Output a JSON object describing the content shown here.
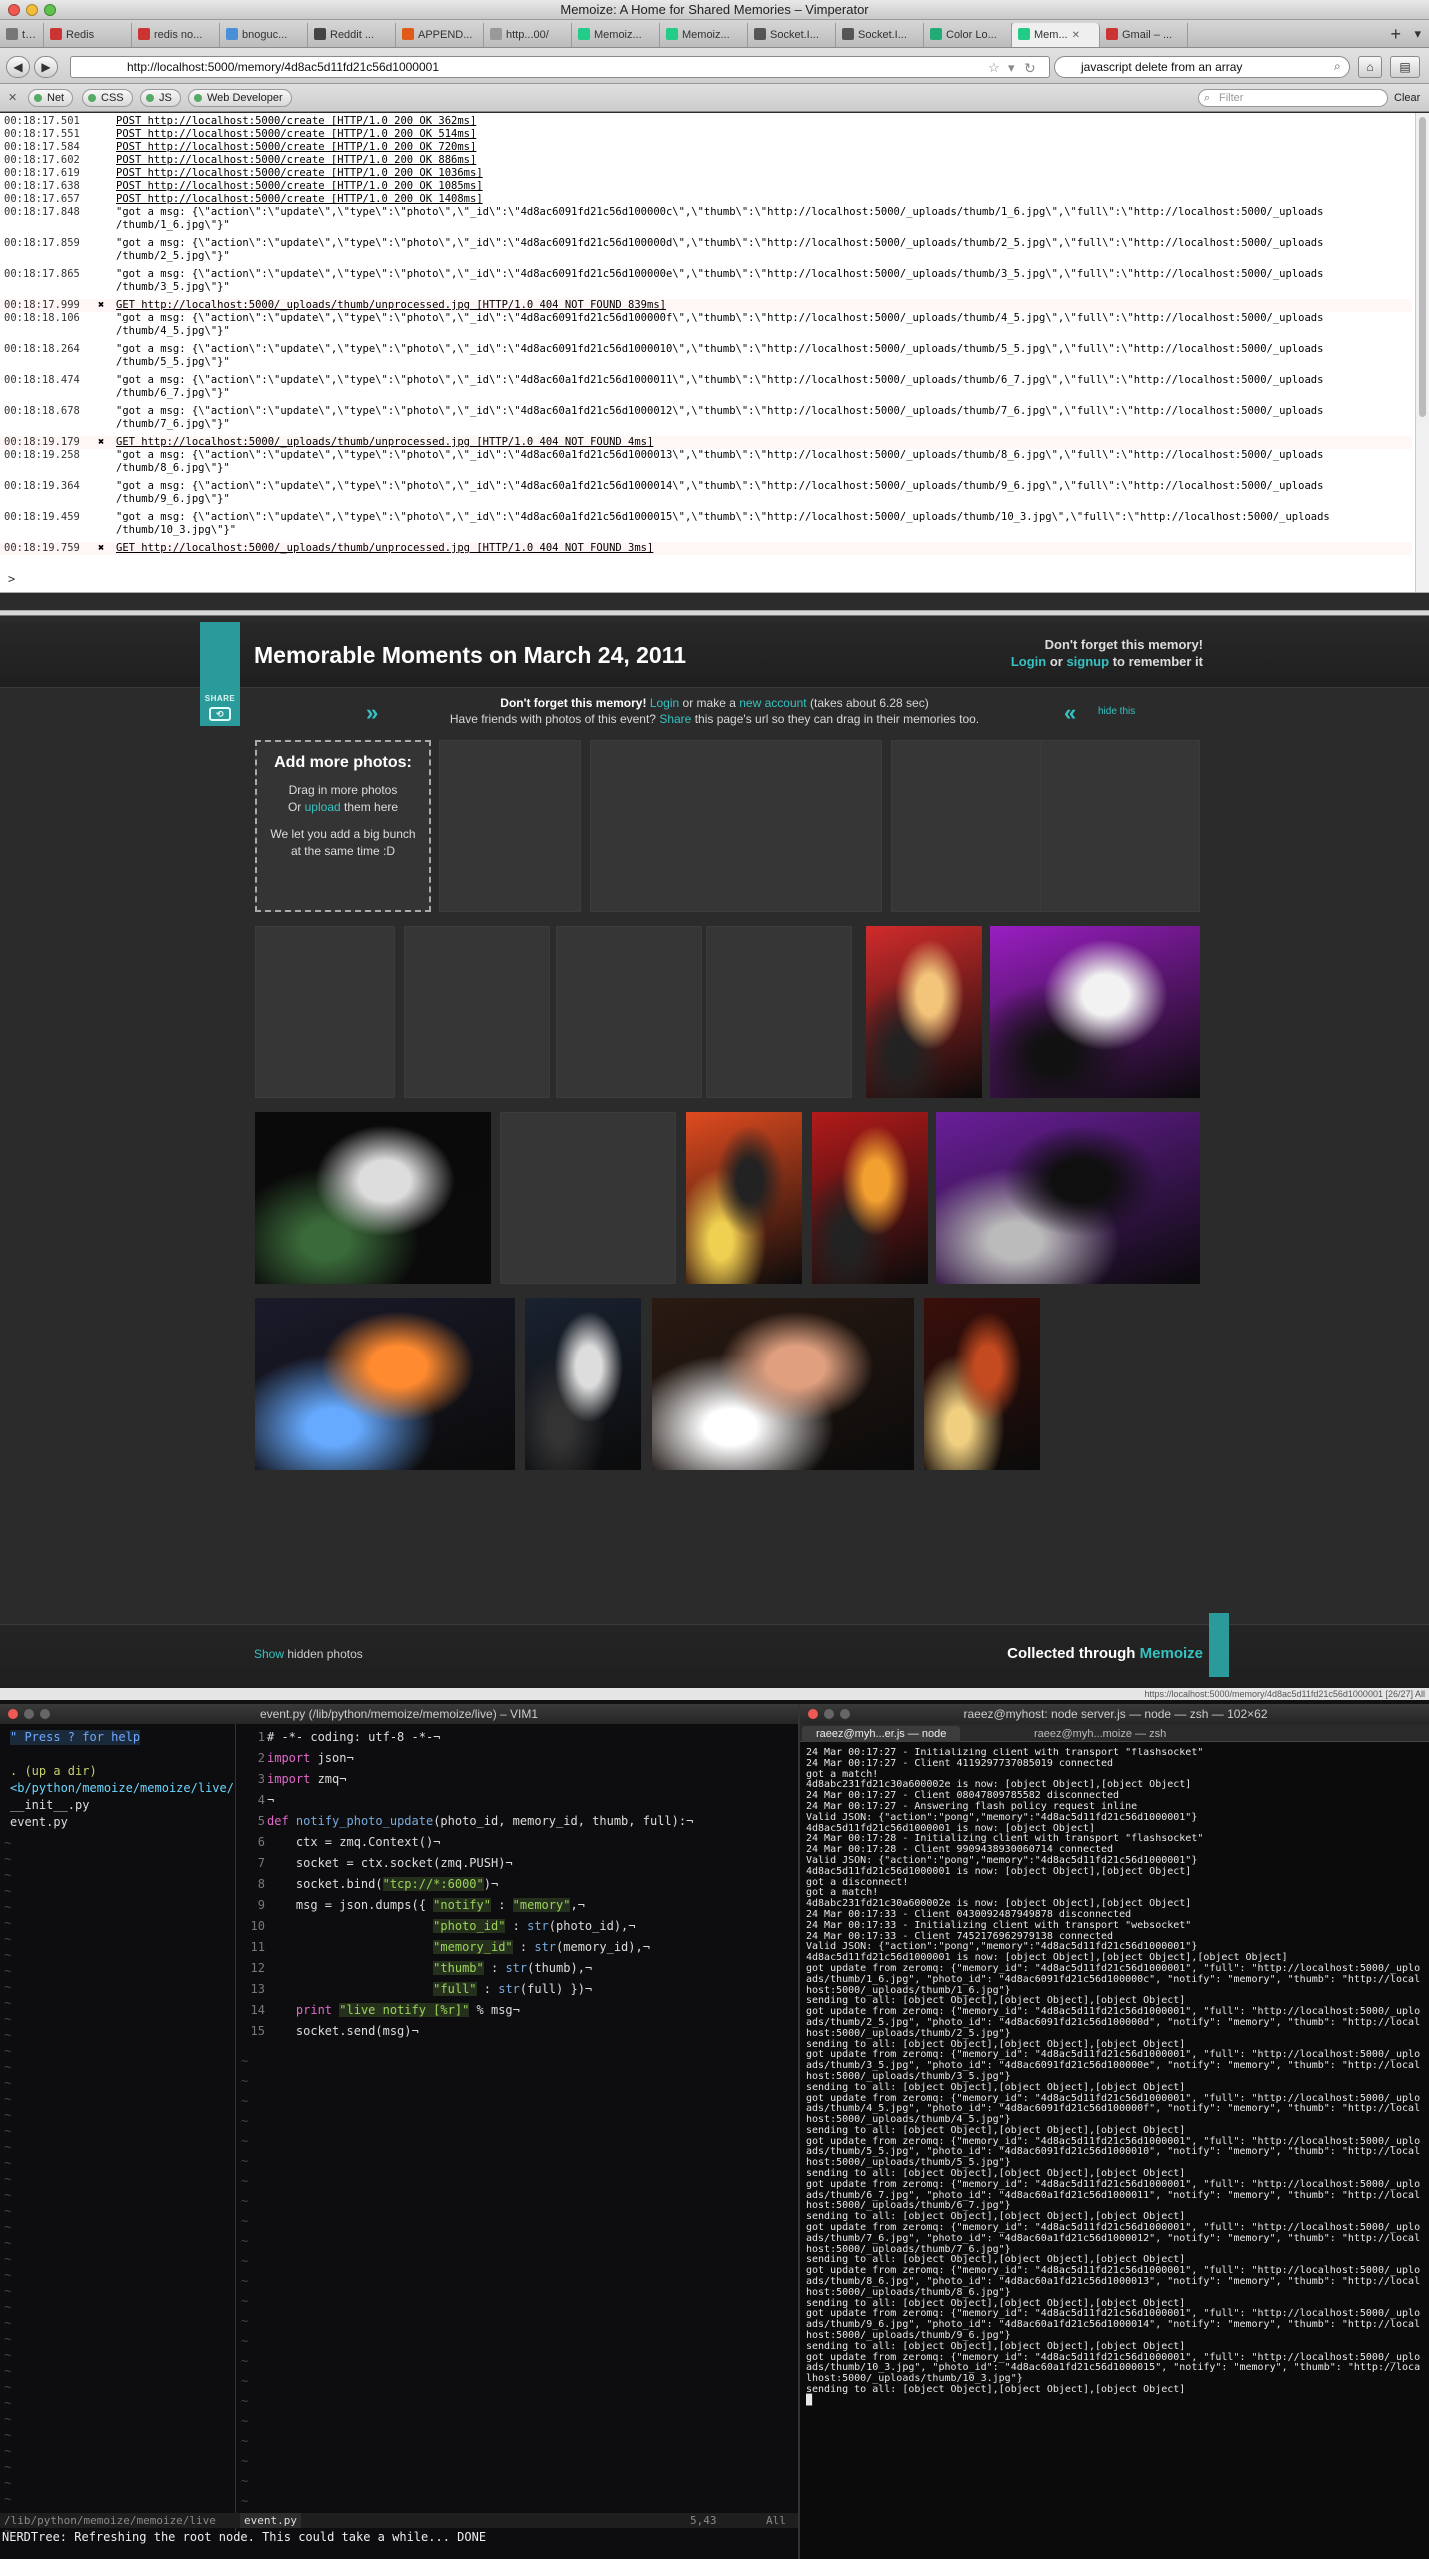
{
  "window": {
    "title": "Memoize: A Home for Shared Memories – Vimperator"
  },
  "tabs": [
    {
      "label": "tu..."
    },
    {
      "label": "Redis"
    },
    {
      "label": "redis no..."
    },
    {
      "label": "bnoguc..."
    },
    {
      "label": "Reddit ..."
    },
    {
      "label": "APPEND..."
    },
    {
      "label": "http...00/"
    },
    {
      "label": "Memoiz..."
    },
    {
      "label": "Memoiz..."
    },
    {
      "label": "Socket.I..."
    },
    {
      "label": "Socket.I..."
    },
    {
      "label": "Color Lo..."
    },
    {
      "label": "Mem..."
    },
    {
      "label": "Gmail – ..."
    }
  ],
  "nav": {
    "back": "◀",
    "forward": "▶",
    "url": "http://localhost:5000/memory/4d8ac5d11fd21c56d1000001",
    "site_badge": "S",
    "search_value": "javascript delete from an array",
    "new_tab": "+"
  },
  "addons": {
    "net": "Net",
    "css": "CSS",
    "js": "JS",
    "webdev": "Web Developer",
    "filter_placeholder": "Filter",
    "clear": "Clear"
  },
  "console": {
    "lines": [
      {
        "ts": "00:18:17.501",
        "mk": "",
        "msg": "POST http://localhost:5000/create [HTTP/1.0 200 OK 362ms]"
      },
      {
        "ts": "00:18:17.551",
        "mk": "",
        "msg": "POST http://localhost:5000/create [HTTP/1.0 200 OK 514ms]"
      },
      {
        "ts": "00:18:17.584",
        "mk": "",
        "msg": "POST http://localhost:5000/create [HTTP/1.0 200 OK 720ms]"
      },
      {
        "ts": "00:18:17.602",
        "mk": "",
        "msg": "POST http://localhost:5000/create [HTTP/1.0 200 OK 886ms]"
      },
      {
        "ts": "00:18:17.619",
        "mk": "",
        "msg": "POST http://localhost:5000/create [HTTP/1.0 200 OK 1036ms]"
      },
      {
        "ts": "00:18:17.638",
        "mk": "",
        "msg": "POST http://localhost:5000/create [HTTP/1.0 200 OK 1085ms]"
      },
      {
        "ts": "00:18:17.657",
        "mk": "",
        "msg": "POST http://localhost:5000/create [HTTP/1.0 200 OK 1408ms]"
      },
      {
        "ts": "00:18:17.848",
        "mk": "",
        "msg": "\"got a msg: {\\\"action\\\":\\\"update\\\",\\\"type\\\":\\\"photo\\\",\\\"_id\\\":\\\"4d8ac6091fd21c56d100000c\\\",\\\"thumb\\\":\\\"http://localhost:5000/_uploads/thumb/1_6.jpg\\\",\\\"full\\\":\\\"http://localhost:5000/_uploads\n/thumb/1_6.jpg\\\"}\""
      },
      {
        "ts": "00:18:17.859",
        "mk": "",
        "msg": "\"got a msg: {\\\"action\\\":\\\"update\\\",\\\"type\\\":\\\"photo\\\",\\\"_id\\\":\\\"4d8ac6091fd21c56d100000d\\\",\\\"thumb\\\":\\\"http://localhost:5000/_uploads/thumb/2_5.jpg\\\",\\\"full\\\":\\\"http://localhost:5000/_uploads\n/thumb/2_5.jpg\\\"}\""
      },
      {
        "ts": "00:18:17.865",
        "mk": "",
        "msg": "\"got a msg: {\\\"action\\\":\\\"update\\\",\\\"type\\\":\\\"photo\\\",\\\"_id\\\":\\\"4d8ac6091fd21c56d100000e\\\",\\\"thumb\\\":\\\"http://localhost:5000/_uploads/thumb/3_5.jpg\\\",\\\"full\\\":\\\"http://localhost:5000/_uploads\n/thumb/3_5.jpg\\\"}\""
      },
      {
        "ts": "00:18:17.999",
        "mk": "✖",
        "msg": "GET http://localhost:5000/_uploads/thumb/unprocessed.jpg [HTTP/1.0 404 NOT FOUND 839ms]"
      },
      {
        "ts": "00:18:18.106",
        "mk": "",
        "msg": "\"got a msg: {\\\"action\\\":\\\"update\\\",\\\"type\\\":\\\"photo\\\",\\\"_id\\\":\\\"4d8ac6091fd21c56d100000f\\\",\\\"thumb\\\":\\\"http://localhost:5000/_uploads/thumb/4_5.jpg\\\",\\\"full\\\":\\\"http://localhost:5000/_uploads\n/thumb/4_5.jpg\\\"}\""
      },
      {
        "ts": "00:18:18.264",
        "mk": "",
        "msg": "\"got a msg: {\\\"action\\\":\\\"update\\\",\\\"type\\\":\\\"photo\\\",\\\"_id\\\":\\\"4d8ac6091fd21c56d1000010\\\",\\\"thumb\\\":\\\"http://localhost:5000/_uploads/thumb/5_5.jpg\\\",\\\"full\\\":\\\"http://localhost:5000/_uploads\n/thumb/5_5.jpg\\\"}\""
      },
      {
        "ts": "00:18:18.474",
        "mk": "",
        "msg": "\"got a msg: {\\\"action\\\":\\\"update\\\",\\\"type\\\":\\\"photo\\\",\\\"_id\\\":\\\"4d8ac60a1fd21c56d1000011\\\",\\\"thumb\\\":\\\"http://localhost:5000/_uploads/thumb/6_7.jpg\\\",\\\"full\\\":\\\"http://localhost:5000/_uploads\n/thumb/6_7.jpg\\\"}\""
      },
      {
        "ts": "00:18:18.678",
        "mk": "",
        "msg": "\"got a msg: {\\\"action\\\":\\\"update\\\",\\\"type\\\":\\\"photo\\\",\\\"_id\\\":\\\"4d8ac60a1fd21c56d1000012\\\",\\\"thumb\\\":\\\"http://localhost:5000/_uploads/thumb/7_6.jpg\\\",\\\"full\\\":\\\"http://localhost:5000/_uploads\n/thumb/7_6.jpg\\\"}\""
      },
      {
        "ts": "00:18:19.179",
        "mk": "✖",
        "msg": "GET http://localhost:5000/_uploads/thumb/unprocessed.jpg [HTTP/1.0 404 NOT FOUND 4ms]"
      },
      {
        "ts": "00:18:19.258",
        "mk": "",
        "msg": "\"got a msg: {\\\"action\\\":\\\"update\\\",\\\"type\\\":\\\"photo\\\",\\\"_id\\\":\\\"4d8ac60a1fd21c56d1000013\\\",\\\"thumb\\\":\\\"http://localhost:5000/_uploads/thumb/8_6.jpg\\\",\\\"full\\\":\\\"http://localhost:5000/_uploads\n/thumb/8_6.jpg\\\"}\""
      },
      {
        "ts": "00:18:19.364",
        "mk": "",
        "msg": "\"got a msg: {\\\"action\\\":\\\"update\\\",\\\"type\\\":\\\"photo\\\",\\\"_id\\\":\\\"4d8ac60a1fd21c56d1000014\\\",\\\"thumb\\\":\\\"http://localhost:5000/_uploads/thumb/9_6.jpg\\\",\\\"full\\\":\\\"http://localhost:5000/_uploads\n/thumb/9_6.jpg\\\"}\""
      },
      {
        "ts": "00:18:19.459",
        "mk": "",
        "msg": "\"got a msg: {\\\"action\\\":\\\"update\\\",\\\"type\\\":\\\"photo\\\",\\\"_id\\\":\\\"4d8ac60a1fd21c56d1000015\\\",\\\"thumb\\\":\\\"http://localhost:5000/_uploads/thumb/10_3.jpg\\\",\\\"full\\\":\\\"http://localhost:5000/_uploads\n/thumb/10_3.jpg\\\"}\""
      },
      {
        "ts": "00:18:19.759",
        "mk": "✖",
        "msg": "GET http://localhost:5000/_uploads/thumb/unprocessed.jpg [HTTP/1.0 404 NOT FOUND 3ms]"
      }
    ],
    "prompt": ">"
  },
  "page": {
    "share_label": "SHARE",
    "title": "Memorable Moments on March 24, 2011",
    "header_right_1": "Don't forget this memory!",
    "header_right_login": "Login",
    "header_right_or": "or",
    "header_right_signup": "signup",
    "header_right_tail": "to remember it",
    "info_strong": "Don't forget this memory!",
    "info_login": "Login",
    "info_mid": "or make a",
    "info_new_account": "new account",
    "info_tail": "(takes about 6.28 sec)",
    "info2_lead": "Have friends with photos of this event?",
    "info2_share": "Share",
    "info2_tail": "this page's url so they can drag in their memories too.",
    "hide_this": "hide this",
    "add_more": {
      "title": "Add more photos:",
      "line1": "Drag in more photos",
      "line2_or": "Or",
      "line2_upload": "upload",
      "line2_tail": "them here",
      "line3": "We let you add a big bunch at the same time :D"
    },
    "footer_show": "Show",
    "footer_hidden": "hidden photos",
    "footer_collected": "Collected through",
    "footer_brand": "Memoize",
    "status_url": "https://localhost:5000/memory/4d8ac5d11fd21c56d1000001 [26/27] All"
  },
  "photos": [
    {
      "caption": "",
      "colors": [
        "#d12b2b",
        "#f3c57a",
        "#222"
      ]
    },
    {
      "caption": "",
      "colors": [
        "#9a1ec2",
        "#f2f2f2",
        "#111"
      ]
    },
    {
      "caption": "",
      "colors": [
        "#0a0a0a",
        "#ddd",
        "#3a6a3a"
      ]
    },
    {
      "caption": "",
      "colors": [
        "#e04b1f",
        "#222",
        "#f0d050"
      ]
    },
    {
      "caption": "",
      "colors": [
        "#b31a1a",
        "#f2a030",
        "#222"
      ]
    },
    {
      "caption": "",
      "colors": [
        "#6a1e9a",
        "#0f0f0f",
        "#bbb"
      ]
    },
    {
      "caption": "",
      "colors": [
        "#1a1a2a",
        "#ff8a30",
        "#6af"
      ]
    },
    {
      "caption": "",
      "colors": [
        "#1a2230",
        "#ddd",
        "#333"
      ]
    },
    {
      "caption": "",
      "colors": [
        "#2a1a12",
        "#e0a080",
        "#fff"
      ]
    },
    {
      "caption": "",
      "colors": [
        "#3a0f0a",
        "#c44a20",
        "#f0d080"
      ]
    }
  ],
  "vim": {
    "title": "event.py (/lib/python/memoize/memoize/live) – VIM1",
    "nerd_rows": [
      {
        "text": "\" Press ? for help",
        "color": "#6fa8ff",
        "bg": "#1b2a3a"
      },
      {
        "text": "",
        "color": "#ddd",
        "bg": ""
      },
      {
        "text": ". (up a dir)",
        "color": "#c7d06a",
        "bg": ""
      },
      {
        "text": "<b/python/memoize/memoize/live/",
        "color": "#6cd6ff",
        "bg": ""
      },
      {
        "text": "  __init__.py",
        "color": "#ddd",
        "bg": ""
      },
      {
        "text": "  event.py",
        "color": "#ddd",
        "bg": ""
      }
    ],
    "code": [
      {
        "n": "1",
        "html": "# -*- coding: utf-8 -*-¬"
      },
      {
        "n": "2",
        "html": "import json¬"
      },
      {
        "n": "3",
        "html": "import zmq¬"
      },
      {
        "n": "4",
        "html": "¬"
      },
      {
        "n": "5",
        "html": "def notify_photo_update(photo_id, memory_id, thumb, full):¬"
      },
      {
        "n": "6",
        "html": "    ctx = zmq.Context()¬"
      },
      {
        "n": "7",
        "html": "    socket = ctx.socket(zmq.PUSH)¬"
      },
      {
        "n": "8",
        "html": "    socket.bind(\"tcp://*:6000\")¬"
      },
      {
        "n": "9",
        "html": "    msg = json.dumps({ \"notify\" : \"memory\",¬"
      },
      {
        "n": "10",
        "html": "                       \"photo_id\" : str(photo_id),¬"
      },
      {
        "n": "11",
        "html": "                       \"memory_id\" : str(memory_id),¬"
      },
      {
        "n": "12",
        "html": "                       \"thumb\" : str(thumb),¬"
      },
      {
        "n": "13",
        "html": "                       \"full\" : str(full) })¬"
      },
      {
        "n": "14",
        "html": "    print \"live notify [%r]\" % msg¬"
      },
      {
        "n": "15",
        "html": "    socket.send(msg)¬"
      }
    ],
    "status_left": "/lib/python/memoize/memoize/live",
    "status_file": "event.py",
    "status_pos": "5,43",
    "status_all": "All",
    "cmdline": "NERDTree: Refreshing the root node. This could take a while... DONE"
  },
  "terminal": {
    "title": "raeez@myhost: node server.js — node — zsh — 102×62",
    "tab1": "raeez@myh...er.js — node",
    "tab2": "raeez@myh...moize — zsh",
    "lines": [
      "24 Mar 00:17:27 - Initializing client with transport \"flashsocket\"",
      "24 Mar 00:17:27 - Client 4119297737085019 connected",
      "got a match!",
      "4d8abc231fd21c30a600002e is now: [object Object],[object Object]",
      "24 Mar 00:17:27 - Client 08047809785582 disconnected",
      "24 Mar 00:17:27 - Answering flash policy request inline",
      "Valid JSON: {\"action\":\"pong\",\"memory\":\"4d8ac5d11fd21c56d1000001\"}",
      "4d8ac5d11fd21c56d1000001 is now: [object Object]",
      "24 Mar 00:17:28 - Initializing client with transport \"flashsocket\"",
      "24 Mar 00:17:28 - Client 9909438930060714 connected",
      "Valid JSON: {\"action\":\"pong\",\"memory\":\"4d8ac5d11fd21c56d1000001\"}",
      "4d8ac5d11fd21c56d1000001 is now: [object Object],[object Object]",
      "got a disconnect!",
      "got a match!",
      "4d8abc231fd21c30a600002e is now: [object Object],[object Object]",
      "24 Mar 00:17:33 - Client 0430092487949878 disconnected",
      "24 Mar 00:17:33 - Initializing client with transport \"websocket\"",
      "24 Mar 00:17:33 - Client 7452176962979138 connected",
      "Valid JSON: {\"action\":\"pong\",\"memory\":\"4d8ac5d11fd21c56d1000001\"}",
      "4d8ac5d11fd21c56d1000001 is now: [object Object],[object Object],[object Object]",
      "got update from zeromq: {\"memory_id\": \"4d8ac5d11fd21c56d1000001\", \"full\": \"http://localhost:5000/_uploads/thumb/1_6.jpg\", \"photo_id\": \"4d8ac6091fd21c56d100000c\", \"notify\": \"memory\", \"thumb\": \"http://localhost:5000/_uploads/thumb/1_6.jpg\"}",
      "sending to all: [object Object],[object Object],[object Object]",
      "got update from zeromq: {\"memory_id\": \"4d8ac5d11fd21c56d1000001\", \"full\": \"http://localhost:5000/_uploads/thumb/2_5.jpg\", \"photo_id\": \"4d8ac6091fd21c56d100000d\", \"notify\": \"memory\", \"thumb\": \"http://localhost:5000/_uploads/thumb/2_5.jpg\"}",
      "sending to all: [object Object],[object Object],[object Object]",
      "got update from zeromq: {\"memory_id\": \"4d8ac5d11fd21c56d1000001\", \"full\": \"http://localhost:5000/_uploads/thumb/3_5.jpg\", \"photo_id\": \"4d8ac6091fd21c56d100000e\", \"notify\": \"memory\", \"thumb\": \"http://localhost:5000/_uploads/thumb/3_5.jpg\"}",
      "sending to all: [object Object],[object Object],[object Object]",
      "got update from zeromq: {\"memory_id\": \"4d8ac5d11fd21c56d1000001\", \"full\": \"http://localhost:5000/_uploads/thumb/4_5.jpg\", \"photo_id\": \"4d8ac6091fd21c56d100000f\", \"notify\": \"memory\", \"thumb\": \"http://localhost:5000/_uploads/thumb/4_5.jpg\"}",
      "sending to all: [object Object],[object Object],[object Object]",
      "got update from zeromq: {\"memory_id\": \"4d8ac5d11fd21c56d1000001\", \"full\": \"http://localhost:5000/_uploads/thumb/5_5.jpg\", \"photo_id\": \"4d8ac6091fd21c56d1000010\", \"notify\": \"memory\", \"thumb\": \"http://localhost:5000/_uploads/thumb/5_5.jpg\"}",
      "sending to all: [object Object],[object Object],[object Object]",
      "got update from zeromq: {\"memory_id\": \"4d8ac5d11fd21c56d1000001\", \"full\": \"http://localhost:5000/_uploads/thumb/6_7.jpg\", \"photo_id\": \"4d8ac60a1fd21c56d1000011\", \"notify\": \"memory\", \"thumb\": \"http://localhost:5000/_uploads/thumb/6_7.jpg\"}",
      "sending to all: [object Object],[object Object],[object Object]",
      "got update from zeromq: {\"memory_id\": \"4d8ac5d11fd21c56d1000001\", \"full\": \"http://localhost:5000/_uploads/thumb/7_6.jpg\", \"photo_id\": \"4d8ac60a1fd21c56d1000012\", \"notify\": \"memory\", \"thumb\": \"http://localhost:5000/_uploads/thumb/7_6.jpg\"}",
      "sending to all: [object Object],[object Object],[object Object]",
      "got update from zeromq: {\"memory_id\": \"4d8ac5d11fd21c56d1000001\", \"full\": \"http://localhost:5000/_uploads/thumb/8_6.jpg\", \"photo_id\": \"4d8ac60a1fd21c56d1000013\", \"notify\": \"memory\", \"thumb\": \"http://localhost:5000/_uploads/thumb/8_6.jpg\"}",
      "sending to all: [object Object],[object Object],[object Object]",
      "got update from zeromq: {\"memory_id\": \"4d8ac5d11fd21c56d1000001\", \"full\": \"http://localhost:5000/_uploads/thumb/9_6.jpg\", \"photo_id\": \"4d8ac60a1fd21c56d1000014\", \"notify\": \"memory\", \"thumb\": \"http://localhost:5000/_uploads/thumb/9_6.jpg\"}",
      "sending to all: [object Object],[object Object],[object Object]",
      "got update from zeromq: {\"memory_id\": \"4d8ac5d11fd21c56d1000001\", \"full\": \"http://localhost:5000/_uploads/thumb/10_3.jpg\", \"photo_id\": \"4d8ac60a1fd21c56d1000015\", \"notify\": \"memory\", \"thumb\": \"http://localhost:5000/_uploads/thumb/10_3.jpg\"}",
      "sending to all: [object Object],[object Object],[object Object]",
      "█"
    ]
  },
  "colors": {
    "accent": "#36c2c2",
    "page_bg": "#2b2b2b",
    "ribbon": "#2a9a9a"
  }
}
